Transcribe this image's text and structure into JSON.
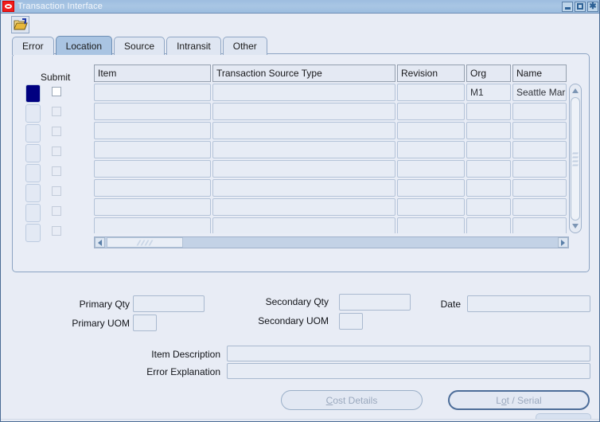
{
  "window": {
    "title": "Transaction Interface",
    "logo_icon": "oracle-logo-icon",
    "controls": {
      "minimize": "minimize-icon",
      "maximize": "maximize-icon",
      "close": "close-icon"
    }
  },
  "toolbar": {
    "open_icon": "open-folder-icon"
  },
  "tabs": [
    {
      "label": "Error",
      "active": false
    },
    {
      "label": "Location",
      "active": true
    },
    {
      "label": "Source",
      "active": false
    },
    {
      "label": "Intransit",
      "active": false
    },
    {
      "label": "Other",
      "active": false
    }
  ],
  "grid": {
    "submit_header": "Submit",
    "columns": [
      "Item",
      "Transaction Source Type",
      "Revision",
      "Org",
      "Name"
    ],
    "rows": [
      {
        "selected": true,
        "submit_enabled": true,
        "submit_checked": false,
        "item": "",
        "transaction_source_type": "",
        "revision": "",
        "org": "M1",
        "name": "Seattle Mar"
      },
      {
        "selected": false,
        "submit_enabled": false,
        "submit_checked": false,
        "item": "",
        "transaction_source_type": "",
        "revision": "",
        "org": "",
        "name": ""
      },
      {
        "selected": false,
        "submit_enabled": false,
        "submit_checked": false,
        "item": "",
        "transaction_source_type": "",
        "revision": "",
        "org": "",
        "name": ""
      },
      {
        "selected": false,
        "submit_enabled": false,
        "submit_checked": false,
        "item": "",
        "transaction_source_type": "",
        "revision": "",
        "org": "",
        "name": ""
      },
      {
        "selected": false,
        "submit_enabled": false,
        "submit_checked": false,
        "item": "",
        "transaction_source_type": "",
        "revision": "",
        "org": "",
        "name": ""
      },
      {
        "selected": false,
        "submit_enabled": false,
        "submit_checked": false,
        "item": "",
        "transaction_source_type": "",
        "revision": "",
        "org": "",
        "name": ""
      },
      {
        "selected": false,
        "submit_enabled": false,
        "submit_checked": false,
        "item": "",
        "transaction_source_type": "",
        "revision": "",
        "org": "",
        "name": ""
      },
      {
        "selected": false,
        "submit_enabled": false,
        "submit_checked": false,
        "item": "",
        "transaction_source_type": "",
        "revision": "",
        "org": "",
        "name": ""
      }
    ],
    "vertical_scrollbar": {
      "up_icon": "scroll-up-arrow-icon",
      "down_icon": "scroll-down-arrow-icon"
    },
    "horizontal_scrollbar": {
      "left_icon": "scroll-left-arrow-icon",
      "right_icon": "scroll-right-arrow-icon"
    }
  },
  "form": {
    "primary_qty_label": "Primary Qty",
    "primary_qty_value": "",
    "primary_uom_label": "Primary UOM",
    "primary_uom_value": "",
    "secondary_qty_label": "Secondary Qty",
    "secondary_qty_value": "",
    "secondary_uom_label": "Secondary UOM",
    "secondary_uom_value": "",
    "date_label": "Date",
    "date_value": "",
    "item_description_label": "Item Description",
    "item_description_value": "",
    "error_explanation_label": "Error Explanation",
    "error_explanation_value": ""
  },
  "buttons": {
    "cost_details": {
      "prefix": "",
      "mnemonic": "C",
      "suffix": "ost Details",
      "enabled": false,
      "focused": false
    },
    "lot_serial": {
      "prefix": "L",
      "mnemonic": "o",
      "suffix": "t / Serial",
      "enabled": false,
      "focused": true
    }
  },
  "colors": {
    "window_bg": "#e8ecf5",
    "titlebar": "#a3c0e1",
    "active_tab": "#a9c4e2",
    "selected_row": "#000080",
    "oracle_red": "#f01c1c",
    "field_bg": "#e7ecf5"
  }
}
